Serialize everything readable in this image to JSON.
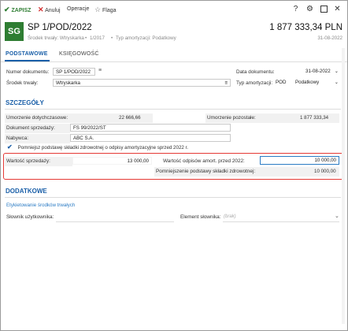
{
  "toolbar": {
    "save_label": "ZAPISZ",
    "cancel_label": "Anuluj",
    "operations_label": "Operacje",
    "flag_label": "Flaga"
  },
  "header": {
    "avatar_text": "SG",
    "title": "SP 1/POD/2022",
    "amount": "1 877 333,34 PLN",
    "subtitle_asset": "Środek trwały: Wtryskarka",
    "subtitle_number": "1/2017",
    "subtitle_type": "Typ amortyzacji: Podatkowy",
    "date": "31-08-2022"
  },
  "tabs": [
    {
      "label": "PODSTAWOWE"
    },
    {
      "label": "KSIĘGOWOŚĆ"
    }
  ],
  "basic": {
    "doc_number_label": "Numer dokumentu:",
    "doc_number_value": "SP 1/POD/2022",
    "doc_date_label": "Data dokumentu:",
    "doc_date_value": "31-08-2022",
    "asset_label": "Środek trwały:",
    "asset_value": "Wtryskarka",
    "amort_type_label": "Typ amortyzacji:",
    "amort_type_code": "POD",
    "amort_type_value": "Podatkowy"
  },
  "details": {
    "section_title": "SZCZEGÓŁY",
    "depr_to_date_label": "Umorzenie dotychczasowe:",
    "depr_to_date_value": "22 666,66",
    "depr_remaining_label": "Umorzenie pozostałe:",
    "depr_remaining_value": "1 877 333,34",
    "sale_doc_label": "Dokument sprzedaży:",
    "sale_doc_value": "FS 99/2022/ST",
    "buyer_label": "Nabywca:",
    "buyer_value": "ABC S.A.",
    "checkbox_label": "Pomniejsz podstawę składki zdrowotnej o odpisy amortyzacyjne sprzed 2022 r.",
    "sale_value_label": "Wartość sprzedaży:",
    "sale_value": "13 000,00",
    "write_off_label": "Wartość odpisów amort. przed 2022:",
    "write_off_value": "10 000,00",
    "reduction_label": "Pomniejszenie podstawy składki zdrowotnej:",
    "reduction_value": "10 000,00"
  },
  "additional": {
    "section_title": "DODATKOWE",
    "link_label": "Etykietowanie środków trwałych",
    "user_dict_label": "Słownik użytkownika:",
    "dict_element_label": "Element słownika:",
    "dict_element_placeholder": "(brak)"
  },
  "colors": {
    "accent": "#1a5fa8",
    "brand": "#2e7d32",
    "highlight": "#e53935"
  }
}
